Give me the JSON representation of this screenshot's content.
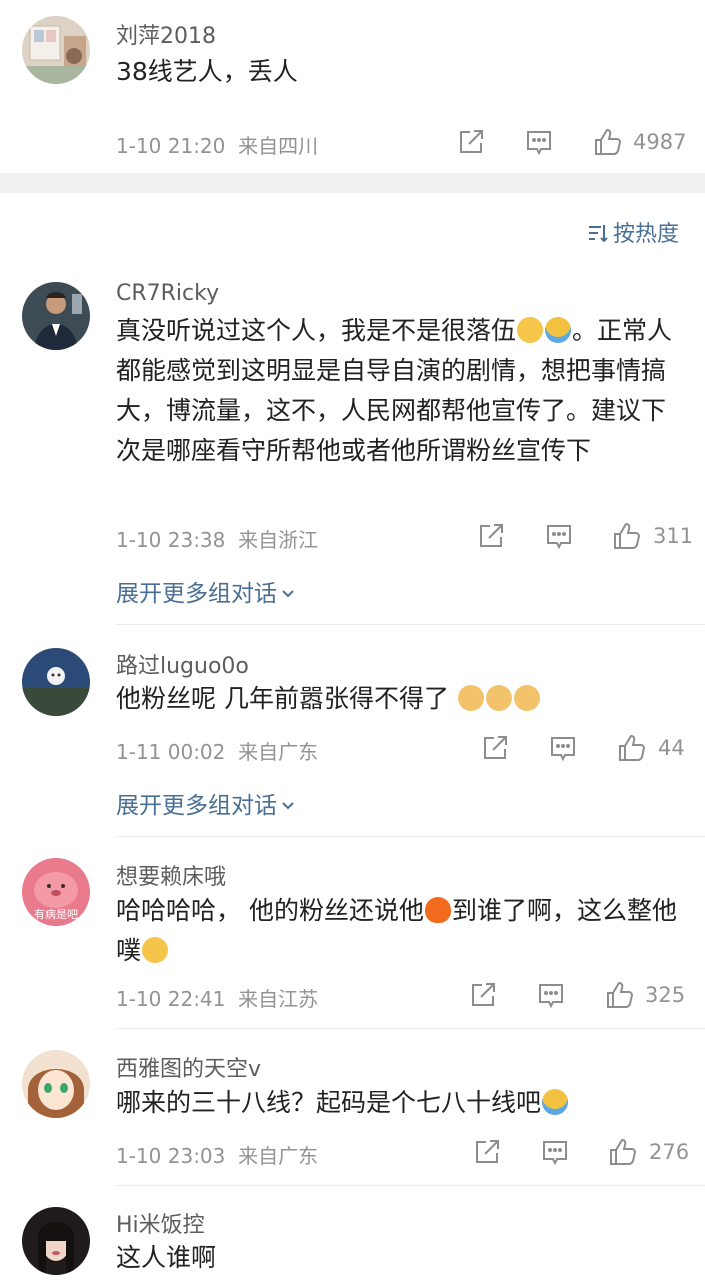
{
  "sort": {
    "label": "按热度"
  },
  "expand_label": "展开更多组对话",
  "comments": [
    {
      "name": "刘萍2018",
      "text": "38线艺人，丢人",
      "time": "1-10 21:20",
      "location": "来自四川",
      "likes": "4987"
    },
    {
      "name": "CR7Ricky",
      "text_a": "真没听说过这个人，我是不是很落伍",
      "text_b": "。正常人都能感觉到这明显是自导自演的剧情，想把事情搞大，博流量，这不，人民网都帮他宣传了。建议下次是哪座看守所帮他或者他所谓粉丝宣传下",
      "time": "1-10 23:38",
      "location": "来自浙江",
      "likes": "311"
    },
    {
      "name": "路过luguo0o",
      "text": "他粉丝呢 几年前嚣张得不得了",
      "time": "1-11 00:02",
      "location": "来自广东",
      "likes": "44"
    },
    {
      "name": "想要赖床哦",
      "avatar_caption": "有病是吧",
      "text_a": "哈哈哈哈， 他的粉丝还说他",
      "text_b": "到谁了啊，这么整他噗",
      "time": "1-10 22:41",
      "location": "来自江苏",
      "likes": "325"
    },
    {
      "name": "西雅图的天空v",
      "text": "哪来的三十八线？起码是个七八十线吧",
      "time": "1-10 23:03",
      "location": "来自广东",
      "likes": "276"
    },
    {
      "name": "Hi米饭控",
      "text": "这人谁啊"
    }
  ]
}
